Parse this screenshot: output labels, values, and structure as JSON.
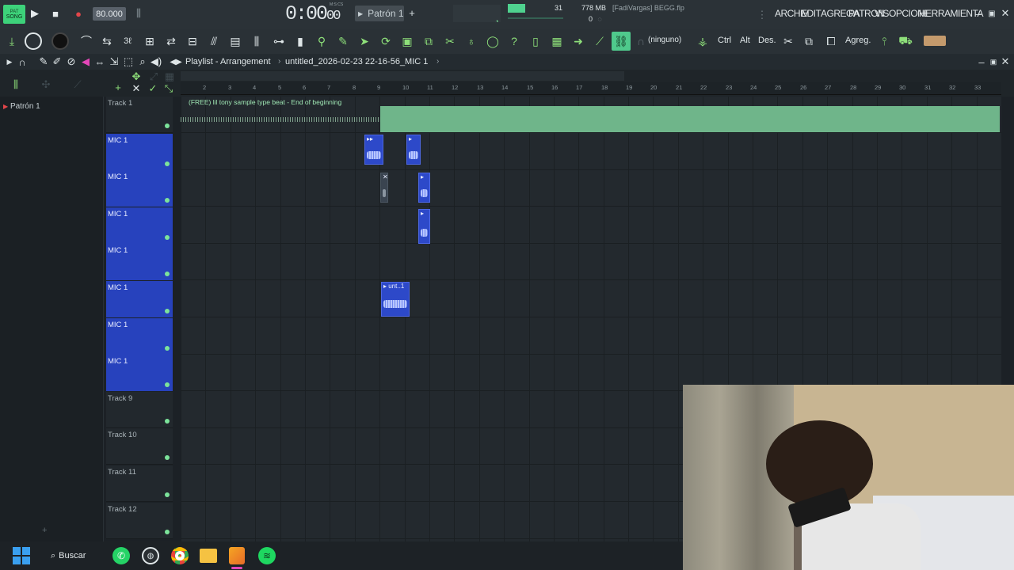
{
  "topbar": {
    "mode_label": "SONG",
    "tempo": "80.000",
    "time": "0:00",
    "time_sub": "00",
    "time_unit": "M:S:CS",
    "pattern": "Patrón 1",
    "cpu_value": "31",
    "memory": "778 MB",
    "poly": "0",
    "project_hint": "[FadiVargas] BEGG.flp",
    "menus": [
      "ARCHIV",
      "EDIT",
      "AGREGA",
      "PATRON",
      "VIS",
      "OPCIONE",
      "HERRAMIENTA"
    ]
  },
  "toolbar": {
    "snap_none": "(ninguno)",
    "ctrl": "Ctrl",
    "alt": "Alt",
    "des": "Des.",
    "agreg": "Agreg."
  },
  "playlist": {
    "title": "Playlist - Arrangement",
    "file": "untitled_2026-02-23 22-16-56_MIC 1"
  },
  "sidebar": {
    "item": "Patrón 1"
  },
  "ruler": [
    "2",
    "3",
    "4",
    "5",
    "6",
    "7",
    "8",
    "9",
    "10",
    "11",
    "12",
    "13",
    "14",
    "15",
    "16",
    "17",
    "18",
    "19",
    "20",
    "21",
    "22",
    "23",
    "24",
    "25",
    "26",
    "27",
    "28",
    "29",
    "30",
    "31",
    "32",
    "33"
  ],
  "tracks": [
    {
      "name": "Track 1",
      "selected": false
    },
    {
      "name": "MIC 1",
      "selected": true
    },
    {
      "name": "MIC 1",
      "selected": true
    },
    {
      "name": "MIC 1",
      "selected": true
    },
    {
      "name": "MIC 1",
      "selected": true
    },
    {
      "name": "MIC 1",
      "selected": true
    },
    {
      "name": "MIC 1",
      "selected": true
    },
    {
      "name": "MIC 1",
      "selected": true
    },
    {
      "name": "Track 9",
      "selected": false
    },
    {
      "name": "Track 10",
      "selected": false
    },
    {
      "name": "Track 11",
      "selected": false
    },
    {
      "name": "Track 12",
      "selected": false
    }
  ],
  "clips": {
    "beat_name": "(FREE) lil tony sample type beat - End of beginning",
    "unt": "unt..1"
  },
  "taskbar": {
    "search": "Buscar"
  },
  "colors": {
    "accent_green": "#8ee07a",
    "track_blue": "#2742bd",
    "beat_green": "#6fb58a"
  }
}
